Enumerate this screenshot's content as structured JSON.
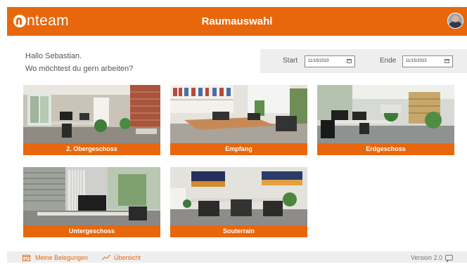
{
  "header": {
    "logo_text": "nteam",
    "title": "Raumauswahl",
    "accent_color": "#e8670c"
  },
  "greeting": {
    "line1": "Hallo Sebastian.",
    "line2": "Wo möchtest du gern arbeiten?"
  },
  "date_range": {
    "start_label": "Start",
    "start_value": "11/15/2023",
    "end_label": "Ende",
    "end_value": "11/15/2023",
    "icon": "calendar-icon"
  },
  "rooms": [
    {
      "label": "2. Obergeschoss"
    },
    {
      "label": "Empfang"
    },
    {
      "label": "Erdgeschoss"
    },
    {
      "label": "Untergeschoss"
    },
    {
      "label": "Souterrain"
    }
  ],
  "footer": {
    "bookings_label": "Meine Belegungen",
    "bookings_icon": "calendar-check-icon",
    "overview_label": "Übersicht",
    "overview_icon": "chart-line-icon",
    "version": "Version 2.0",
    "feedback_icon": "chat-icon"
  }
}
